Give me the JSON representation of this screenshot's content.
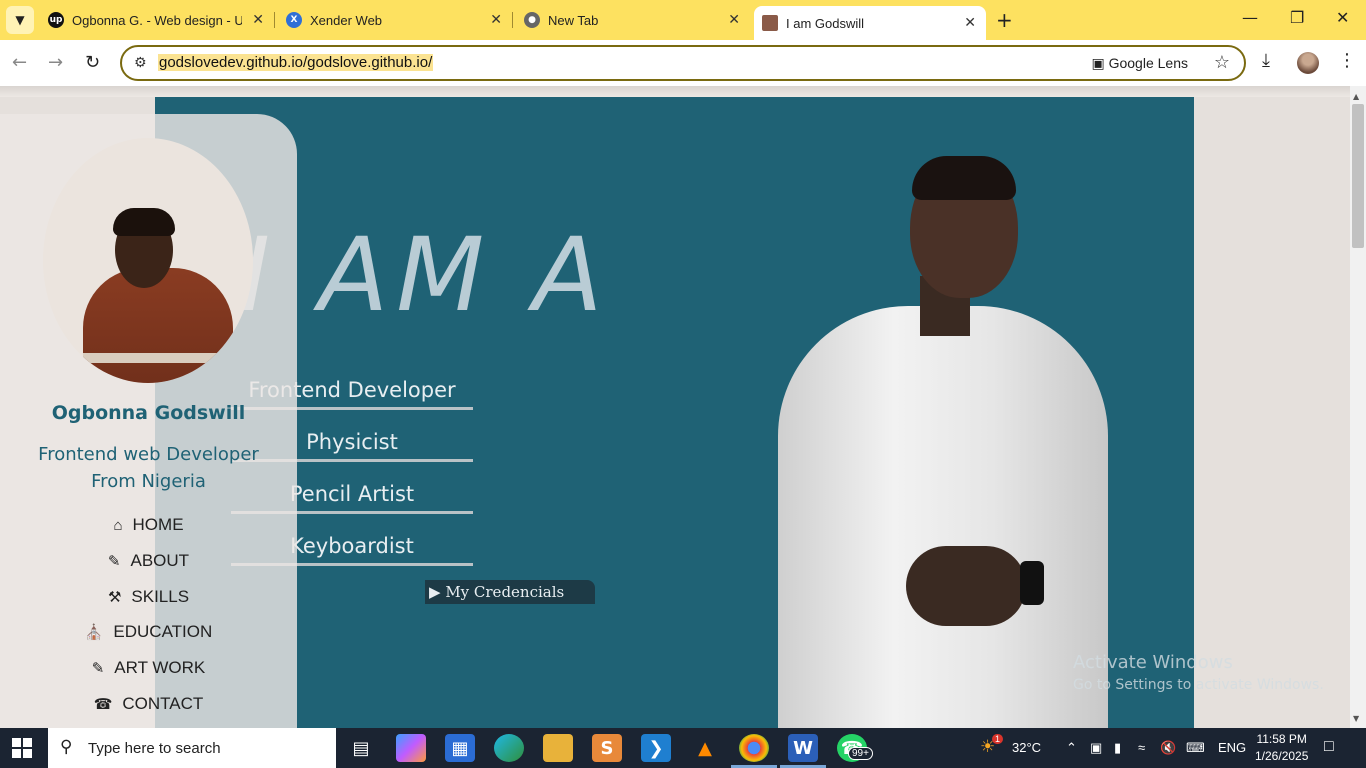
{
  "browser": {
    "tabs": [
      {
        "title": "Ogbonna G. - Web design - Up",
        "favicon": "upwork-icon",
        "favicon_color": "#111111"
      },
      {
        "title": "Xender Web",
        "favicon": "xender-icon",
        "favicon_color": "#2f6fd6"
      },
      {
        "title": "New Tab",
        "favicon": "chrome-icon",
        "favicon_color": "#555555"
      },
      {
        "title": "I am Godswill",
        "favicon": "portrait-icon",
        "favicon_color": "#8a5a48"
      }
    ],
    "url": "godslovedev.github.io/godslove.github.io/",
    "lens_label": "Google Lens",
    "accent": "#fde160"
  },
  "page": {
    "big_title": "I AM A",
    "roles": [
      "Frontend Developer",
      "Physicist",
      "Pencil Artist",
      "Keyboardist"
    ],
    "credentials": "My Credencials",
    "hero_color": "#1f6275"
  },
  "sidebar": {
    "name": "Ogbonna Godswill",
    "tagline_line1": "Frontend web Developer",
    "tagline_line2": "From Nigeria",
    "nav": [
      {
        "label": "HOME",
        "icon": "home-icon"
      },
      {
        "label": "ABOUT",
        "icon": "user-edit-icon"
      },
      {
        "label": "SKILLS",
        "icon": "skills-icon"
      },
      {
        "label": "EDUCATION",
        "icon": "university-icon"
      },
      {
        "label": "ART WORK",
        "icon": "art-icon"
      },
      {
        "label": "CONTACT",
        "icon": "phone-icon"
      }
    ]
  },
  "watermark": {
    "line1": "Activate Windows",
    "line2": "Go to Settings to activate Windows."
  },
  "taskbar": {
    "search_placeholder": "Type here to search",
    "weather": "32°C",
    "language": "ENG",
    "time": "11:58 PM",
    "date": "1/26/2025",
    "whatsapp_badge": "99+",
    "weather_badge": "1"
  }
}
